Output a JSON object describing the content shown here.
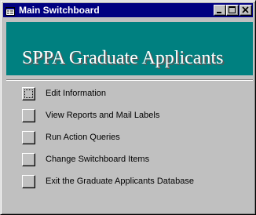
{
  "window": {
    "title": "Main Switchboard",
    "title_icon": "form-icon",
    "controls": [
      "minimize",
      "maximize",
      "close"
    ]
  },
  "header": {
    "title": "SPPA Graduate Applicants",
    "band_color": "#008080"
  },
  "items": [
    {
      "label": "Edit Information"
    },
    {
      "label": "View Reports and Mail Labels"
    },
    {
      "label": "Run Action Queries"
    },
    {
      "label": "Change Switchboard Items"
    },
    {
      "label": "Exit the Graduate Applicants Database"
    }
  ],
  "colors": {
    "titlebar": "#000080",
    "face": "#c0c0c0",
    "header_text": "#ffffff"
  }
}
